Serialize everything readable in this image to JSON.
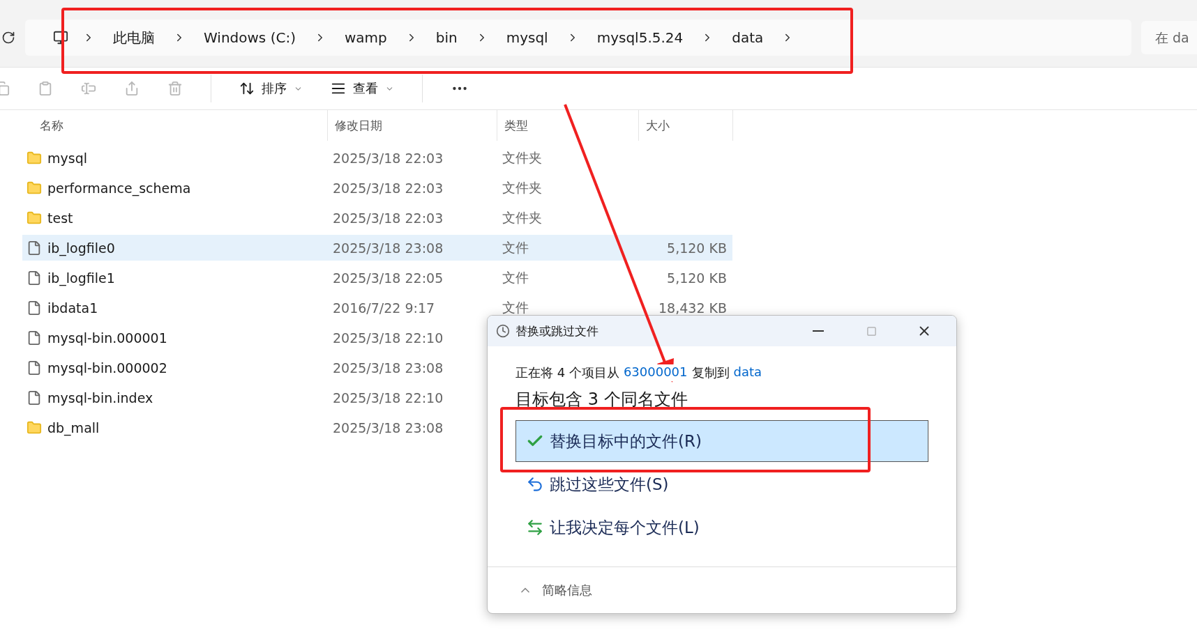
{
  "address_bar": {
    "crumbs": [
      "此电脑",
      "Windows (C:)",
      "wamp",
      "bin",
      "mysql",
      "mysql5.5.24",
      "data"
    ]
  },
  "search": {
    "placeholder": "在 da"
  },
  "toolbar": {
    "actions": [
      {
        "kind": "copy",
        "disabled": true
      },
      {
        "kind": "paste",
        "disabled": true
      },
      {
        "kind": "rename",
        "disabled": true
      },
      {
        "kind": "share",
        "disabled": true
      },
      {
        "kind": "delete",
        "disabled": true
      }
    ],
    "menus": [
      {
        "kind": "sort",
        "label": "排序"
      },
      {
        "kind": "view",
        "label": "查看"
      }
    ]
  },
  "table": {
    "columns": [
      "名称",
      "修改日期",
      "类型",
      "大小"
    ],
    "rows": [
      {
        "kind": "folder",
        "name": "mysql",
        "date": "2025/3/18 22:03",
        "type": "文件夹",
        "selected": false
      },
      {
        "kind": "folder",
        "name": "performance_schema",
        "date": "2025/3/18 22:03",
        "type": "文件夹",
        "selected": false
      },
      {
        "kind": "folder",
        "name": "test",
        "date": "2025/3/18 22:03",
        "type": "文件夹",
        "selected": false
      },
      {
        "kind": "file",
        "name": "ib_logfile0",
        "date": "2025/3/18 23:08",
        "type": "文件",
        "size": "5,120 KB",
        "selected": true
      },
      {
        "kind": "file",
        "name": "ib_logfile1",
        "date": "2025/3/18 22:05",
        "type": "文件",
        "size": "5,120 KB",
        "selected": false
      },
      {
        "kind": "file",
        "name": "ibdata1",
        "date": "2016/7/22 9:17",
        "type": "文件",
        "size": "18,432 KB",
        "selected": false
      },
      {
        "kind": "file",
        "name": "mysql-bin.000001",
        "date": "2025/3/18 22:10",
        "selected": false
      },
      {
        "kind": "file",
        "name": "mysql-bin.000002",
        "date": "2025/3/18 23:08",
        "selected": false
      },
      {
        "kind": "file",
        "name": "mysql-bin.index",
        "date": "2025/3/18 22:10",
        "selected": false
      },
      {
        "kind": "folder",
        "name": "db_mall",
        "date": "2025/3/18 23:08",
        "selected": false
      }
    ]
  },
  "dialog": {
    "title": "替换或跳过文件",
    "copy_line": {
      "prefix": "正在将 4 个项目从",
      "source": "63000001",
      "middle": "复制到",
      "target": "data"
    },
    "heading": "目标包含 3 个同名文件",
    "options": [
      {
        "kind": "replace",
        "label": "替换目标中的文件(R)",
        "selected": true
      },
      {
        "kind": "skip",
        "label": "跳过这些文件(S)",
        "selected": false
      },
      {
        "kind": "decide",
        "label": "让我决定每个文件(L)",
        "selected": false
      }
    ],
    "details_toggle": "简略信息"
  },
  "annotations": [
    {
      "kind": "box"
    },
    {
      "kind": "box"
    },
    {
      "kind": "arrow"
    }
  ]
}
